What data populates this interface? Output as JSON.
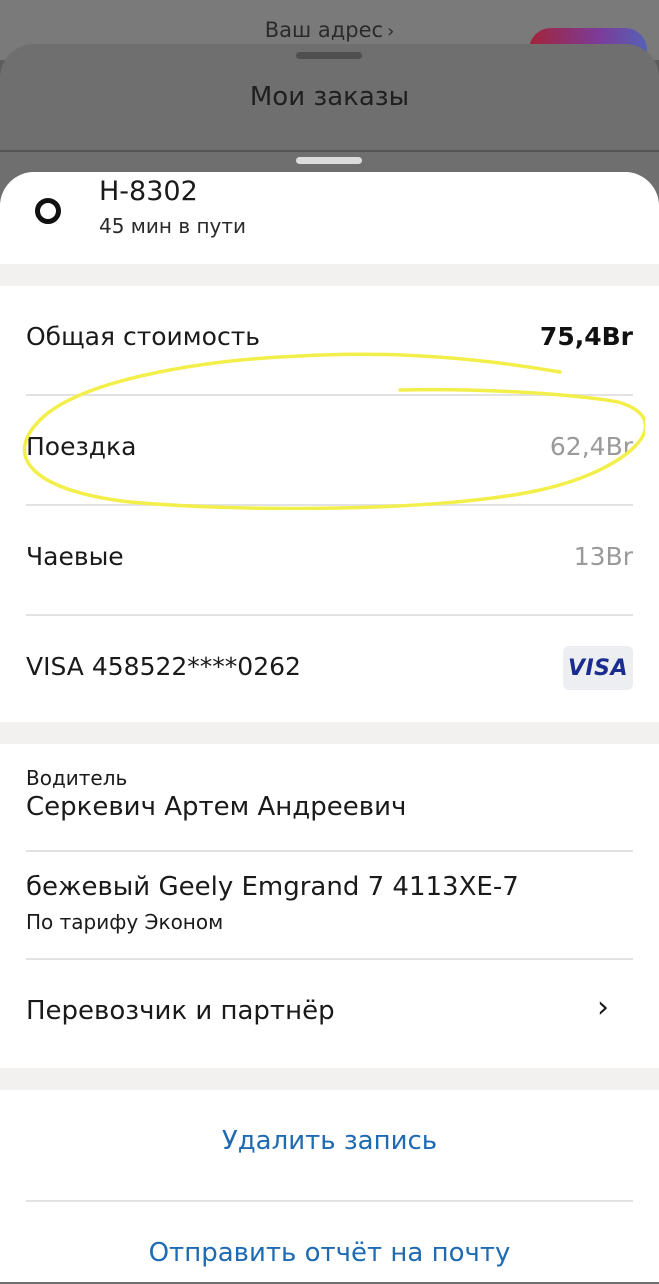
{
  "background": {
    "address_label": "Ваш адрес",
    "address_chevron": "›"
  },
  "sheet": {
    "title": "Мои заказы"
  },
  "order": {
    "number": "Н-8302",
    "duration": "45 мин в пути",
    "status_icon": "ring-icon"
  },
  "cost": {
    "total_label": "Общая стоимость",
    "total_value": "75,4Br",
    "ride_label": "Поездка",
    "ride_value": "62,4Br",
    "tips_label": "Чаевые",
    "tips_value": "13Br",
    "card_label": "VISA 458522****0262",
    "card_brand": "VISA"
  },
  "driver": {
    "caption": "Водитель",
    "name": "Серкевич Артем Андреевич",
    "car": "бежевый Geely Emgrand 7 4113ХЕ-7",
    "tariff": "По тарифу Эконом",
    "partner_label": "Перевозчик и партнёр",
    "partner_chevron": "›"
  },
  "actions": {
    "delete": "Удалить запись",
    "send_report": "Отправить отчёт на почту"
  },
  "colors": {
    "link": "#1f6bb3",
    "highlight": "#f2ef4a",
    "muted_value": "#9a9a9a",
    "visa_blue": "#1a2d8f"
  }
}
